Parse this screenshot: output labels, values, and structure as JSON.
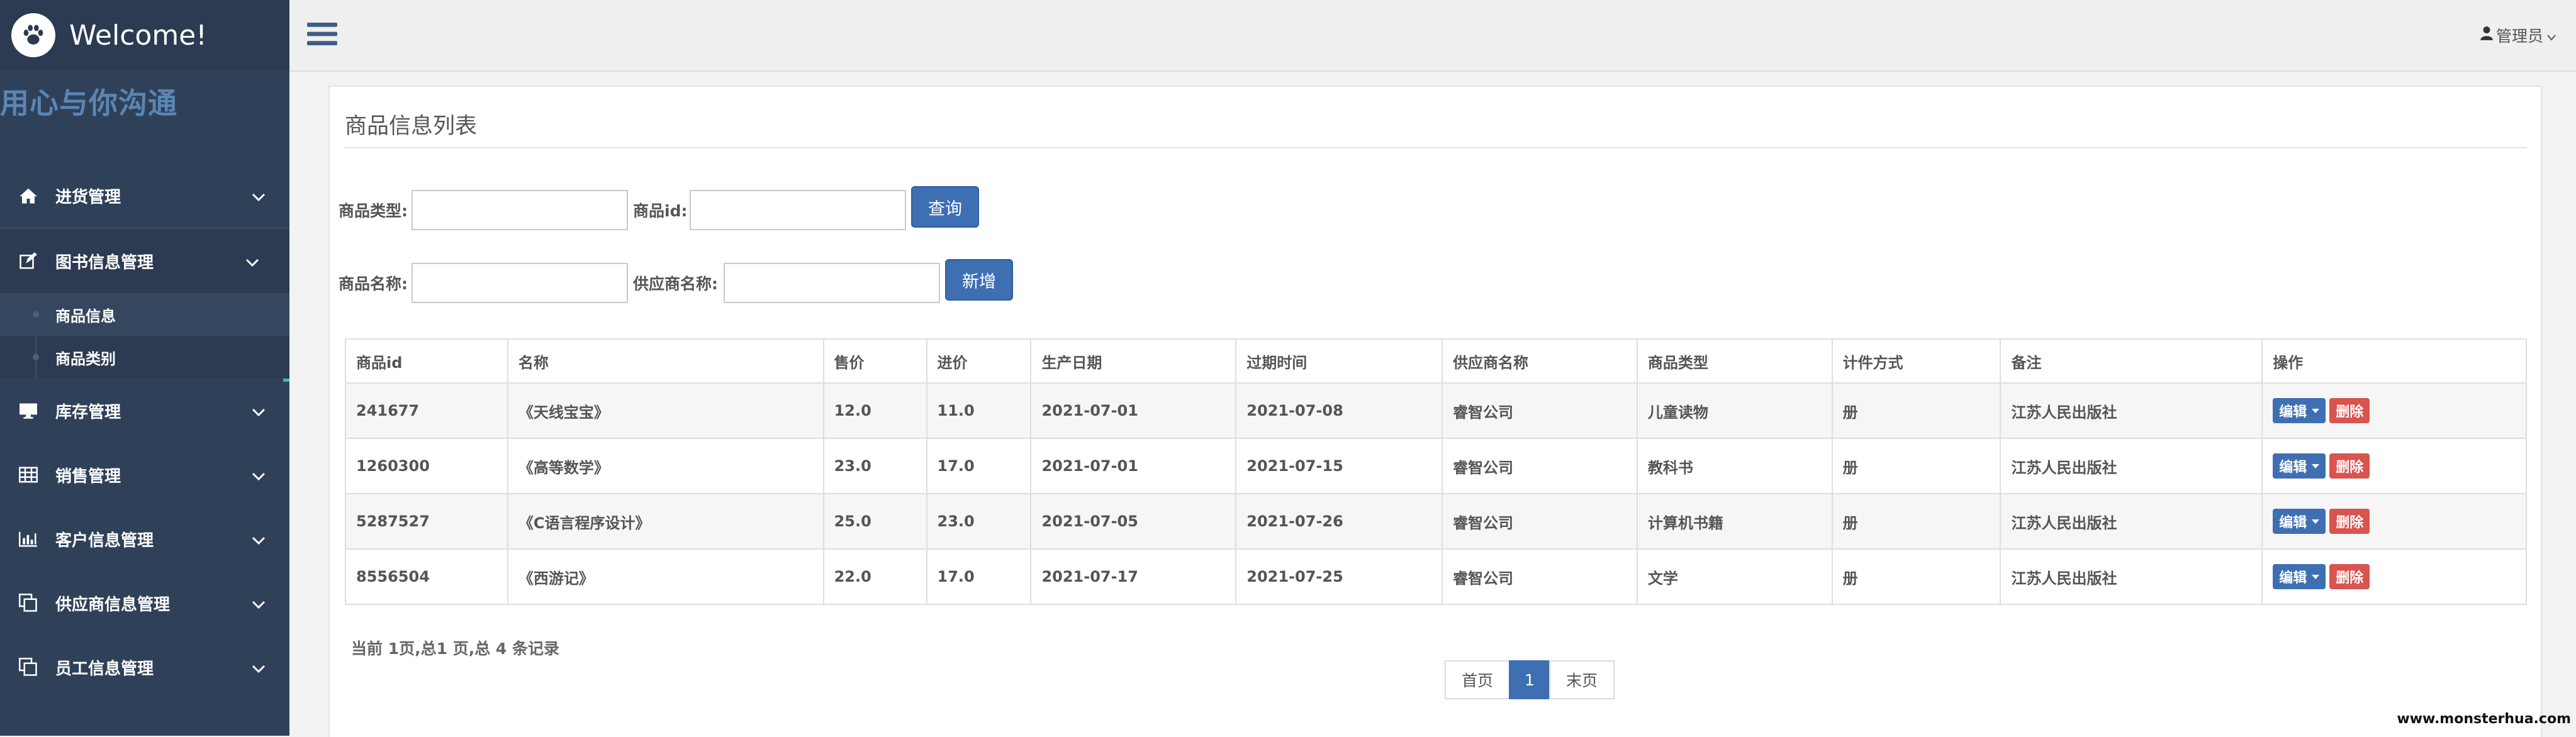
{
  "brand": {
    "title": "Welcome!",
    "slogan": "用心与你沟通"
  },
  "sidebar": {
    "items": [
      {
        "label": "进货管理",
        "icon": "home-icon"
      },
      {
        "label": "图书信息管理",
        "icon": "edit-icon",
        "expanded": true,
        "subitems": [
          {
            "label": "商品信息",
            "selected": true
          },
          {
            "label": "商品类别"
          }
        ]
      },
      {
        "label": "库存管理",
        "icon": "monitor-icon"
      },
      {
        "label": "销售管理",
        "icon": "table-icon"
      },
      {
        "label": "客户信息管理",
        "icon": "bar-chart-icon"
      },
      {
        "label": "供应商信息管理",
        "icon": "copy-icon"
      },
      {
        "label": "员工信息管理",
        "icon": "copy-icon"
      }
    ]
  },
  "topbar": {
    "user": "管理员"
  },
  "panel": {
    "title": "商品信息列表"
  },
  "form": {
    "type_label": "商品类型:",
    "type_value": "",
    "id_label": "商品id:",
    "id_value": "",
    "search_button": "查询",
    "name_label": "商品名称:",
    "name_value": "",
    "supplier_label": "供应商名称:",
    "supplier_value": "",
    "add_button": "新增"
  },
  "table": {
    "columns": [
      "商品id",
      "名称",
      "售价",
      "进价",
      "生产日期",
      "过期时间",
      "供应商名称",
      "商品类型",
      "计件方式",
      "备注",
      "操作"
    ],
    "rows": [
      [
        "241677",
        "《天线宝宝》",
        "12.0",
        "11.0",
        "2021-07-01",
        "2021-07-08",
        "睿智公司",
        "儿童读物",
        "册",
        "江苏人民出版社"
      ],
      [
        "1260300",
        "《高等数学》",
        "23.0",
        "17.0",
        "2021-07-01",
        "2021-07-15",
        "睿智公司",
        "教科书",
        "册",
        "江苏人民出版社"
      ],
      [
        "5287527",
        "《C语言程序设计》",
        "25.0",
        "23.0",
        "2021-07-05",
        "2021-07-26",
        "睿智公司",
        "计算机书籍",
        "册",
        "江苏人民出版社"
      ],
      [
        "8556504",
        "《西游记》",
        "22.0",
        "17.0",
        "2021-07-17",
        "2021-07-25",
        "睿智公司",
        "文学",
        "册",
        "江苏人民出版社"
      ]
    ],
    "edit_label": "编辑",
    "delete_label": "删除"
  },
  "pagination": {
    "info": "当前 1页,总1 页,总 4 条记录",
    "first": "首页",
    "current": "1",
    "last": "末页"
  },
  "watermark": "www.monsterhua.com",
  "colors": {
    "sidebar": "#2f4159",
    "accent": "#3e6fb2",
    "danger": "#d9534f",
    "active_bar": "#44b9a4",
    "slogan": "#5a86b4"
  }
}
